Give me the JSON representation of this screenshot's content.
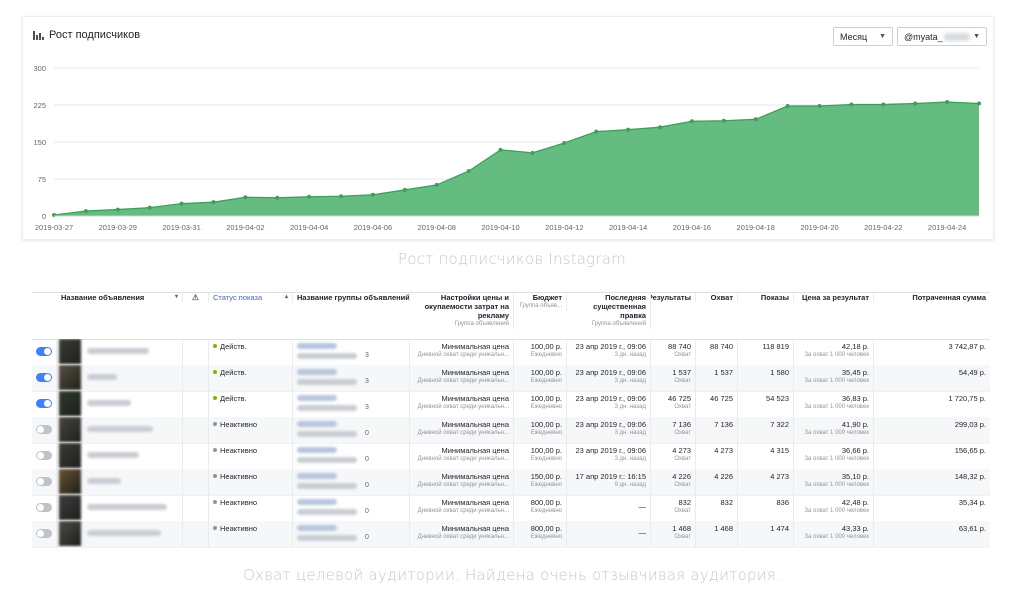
{
  "chart": {
    "title": "Рост подписчиков",
    "period_select": "Месяц",
    "account_select": "@myata_",
    "caption": "Рост подписчиков Instagram"
  },
  "chart_data": {
    "type": "area",
    "x": [
      "2019-03-27",
      "2019-03-28",
      "2019-03-29",
      "2019-03-30",
      "2019-03-31",
      "2019-04-01",
      "2019-04-02",
      "2019-04-03",
      "2019-04-04",
      "2019-04-05",
      "2019-04-06",
      "2019-04-07",
      "2019-04-08",
      "2019-04-09",
      "2019-04-10",
      "2019-04-11",
      "2019-04-12",
      "2019-04-13",
      "2019-04-14",
      "2019-04-15",
      "2019-04-16",
      "2019-04-17",
      "2019-04-18",
      "2019-04-19",
      "2019-04-20",
      "2019-04-21",
      "2019-04-22",
      "2019-04-23",
      "2019-04-24",
      "2019-04-25"
    ],
    "x_ticks": [
      "2019-03-27",
      "2019-03-29",
      "2019-03-31",
      "2019-04-02",
      "2019-04-04",
      "2019-04-06",
      "2019-04-08",
      "2019-04-10",
      "2019-04-12",
      "2019-04-14",
      "2019-04-16",
      "2019-04-18",
      "2019-04-20",
      "2019-04-22",
      "2019-04-24"
    ],
    "series": [
      {
        "values": [
          2,
          10,
          13,
          17,
          25,
          28,
          38,
          37,
          39,
          40,
          43,
          53,
          63,
          91,
          134,
          128,
          148,
          171,
          175,
          180,
          192,
          193,
          196,
          223,
          223,
          226,
          226,
          228,
          231,
          228
        ]
      }
    ],
    "y_ticks": [
      0,
      75,
      150,
      225,
      300
    ],
    "ylim": [
      0,
      300
    ],
    "grid": true,
    "color": "#5cb879"
  },
  "table": {
    "headers": {
      "ad_name": "Название объявления",
      "status": "Статус показа",
      "adset": "Название группы объявлений",
      "bid": "Настройки цены и окупаемости затрат на рекламу",
      "bid_sub": "Группа объявлений",
      "budget": "Бюджет",
      "budget_sub": "Группа объяв...",
      "last_edit": "Последняя существенная правка",
      "last_edit_sub": "Группа объявлений",
      "results": "Результаты",
      "reach": "Охват",
      "impressions": "Показы",
      "cpr": "Цена за результат",
      "spent": "Потраченная сумма"
    },
    "rows": [
      {
        "on": true,
        "status": "Действ.",
        "status_color": "#7fb800",
        "adset_count": "3",
        "bid": "Минимальная цена",
        "bid_sub": "Дневной охват среди уникальн...",
        "budget": "100,00 р.",
        "budget_sub": "Ежедневно",
        "edit": "23 апр 2019 г., 09:06",
        "edit_sub": "3 дн. назад",
        "results": "88 740",
        "results_sub": "Охват",
        "reach": "88 740",
        "impressions": "118 819",
        "cpr": "42,18 р.",
        "cpr_sub": "За охват 1 000 человек",
        "spent": "3 742,87 р."
      },
      {
        "on": true,
        "status": "Действ.",
        "status_color": "#7fb800",
        "adset_count": "3",
        "bid": "Минимальная цена",
        "bid_sub": "Дневной охват среди уникальн...",
        "budget": "100,00 р.",
        "budget_sub": "Ежедневно",
        "edit": "23 апр 2019 г., 09:06",
        "edit_sub": "3 дн. назад",
        "results": "1 537",
        "results_sub": "Охват",
        "reach": "1 537",
        "impressions": "1 580",
        "cpr": "35,45 р.",
        "cpr_sub": "За охват 1 000 человек",
        "spent": "54,49 р."
      },
      {
        "on": true,
        "status": "Действ.",
        "status_color": "#7fb800",
        "adset_count": "3",
        "bid": "Минимальная цена",
        "bid_sub": "Дневной охват среди уникальн...",
        "budget": "100,00 р.",
        "budget_sub": "Ежедневно",
        "edit": "23 апр 2019 г., 09:06",
        "edit_sub": "3 дн. назад",
        "results": "46 725",
        "results_sub": "Охват",
        "reach": "46 725",
        "impressions": "54 523",
        "cpr": "36,83 р.",
        "cpr_sub": "За охват 1 000 человек",
        "spent": "1 720,75 р."
      },
      {
        "on": false,
        "status": "Неактивно",
        "status_color": "#90949c",
        "adset_count": "0",
        "bid": "Минимальная цена",
        "bid_sub": "Дневной охват среди уникальн...",
        "budget": "100,00 р.",
        "budget_sub": "Ежедневно",
        "edit": "23 апр 2019 г., 09:06",
        "edit_sub": "3 дн. назад",
        "results": "7 136",
        "results_sub": "Охват",
        "reach": "7 136",
        "impressions": "7 322",
        "cpr": "41,90 р.",
        "cpr_sub": "За охват 1 000 человек",
        "spent": "299,03 р."
      },
      {
        "on": false,
        "status": "Неактивно",
        "status_color": "#90949c",
        "adset_count": "0",
        "bid": "Минимальная цена",
        "bid_sub": "Дневной охват среди уникальн...",
        "budget": "100,00 р.",
        "budget_sub": "Ежедневно",
        "edit": "23 апр 2019 г., 09:06",
        "edit_sub": "3 дн. назад",
        "results": "4 273",
        "results_sub": "Охват",
        "reach": "4 273",
        "impressions": "4 315",
        "cpr": "36,66 р.",
        "cpr_sub": "За охват 1 000 человек",
        "spent": "156,65 р."
      },
      {
        "on": false,
        "status": "Неактивно",
        "status_color": "#90949c",
        "adset_count": "0",
        "bid": "Минимальная цена",
        "bid_sub": "Дневной охват среди уникальн...",
        "budget": "150,00 р.",
        "budget_sub": "Ежедневно",
        "edit": "17 апр 2019 г.: 16:15",
        "edit_sub": "9 дн. назад",
        "results": "4 226",
        "results_sub": "Охват",
        "reach": "4 226",
        "impressions": "4 273",
        "cpr": "35,10 р.",
        "cpr_sub": "За охват 1 000 человек",
        "spent": "148,32 р."
      },
      {
        "on": false,
        "status": "Неактивно",
        "status_color": "#90949c",
        "adset_count": "0",
        "bid": "Минимальная цена",
        "bid_sub": "Дневной охват среди уникальн...",
        "budget": "800,00 р.",
        "budget_sub": "Ежедневно",
        "edit": "—",
        "edit_sub": "",
        "results": "832",
        "results_sub": "Охват",
        "reach": "832",
        "impressions": "836",
        "cpr": "42,48 р.",
        "cpr_sub": "За охват 1 000 человек",
        "spent": "35,34 р."
      },
      {
        "on": false,
        "status": "Неактивно",
        "status_color": "#90949c",
        "adset_count": "0",
        "bid": "Минимальная цена",
        "bid_sub": "Дневной охват среди уникальн...",
        "budget": "800,00 р.",
        "budget_sub": "Ежедневно",
        "edit": "—",
        "edit_sub": "",
        "results": "1 468",
        "results_sub": "Охват",
        "reach": "1 468",
        "impressions": "1 474",
        "cpr": "43,33 р.",
        "cpr_sub": "За охват 1 000 человек",
        "spent": "63,61 р."
      }
    ],
    "caption": "Охват целевой аудитории. Найдена очень отзывчивая аудитория."
  }
}
